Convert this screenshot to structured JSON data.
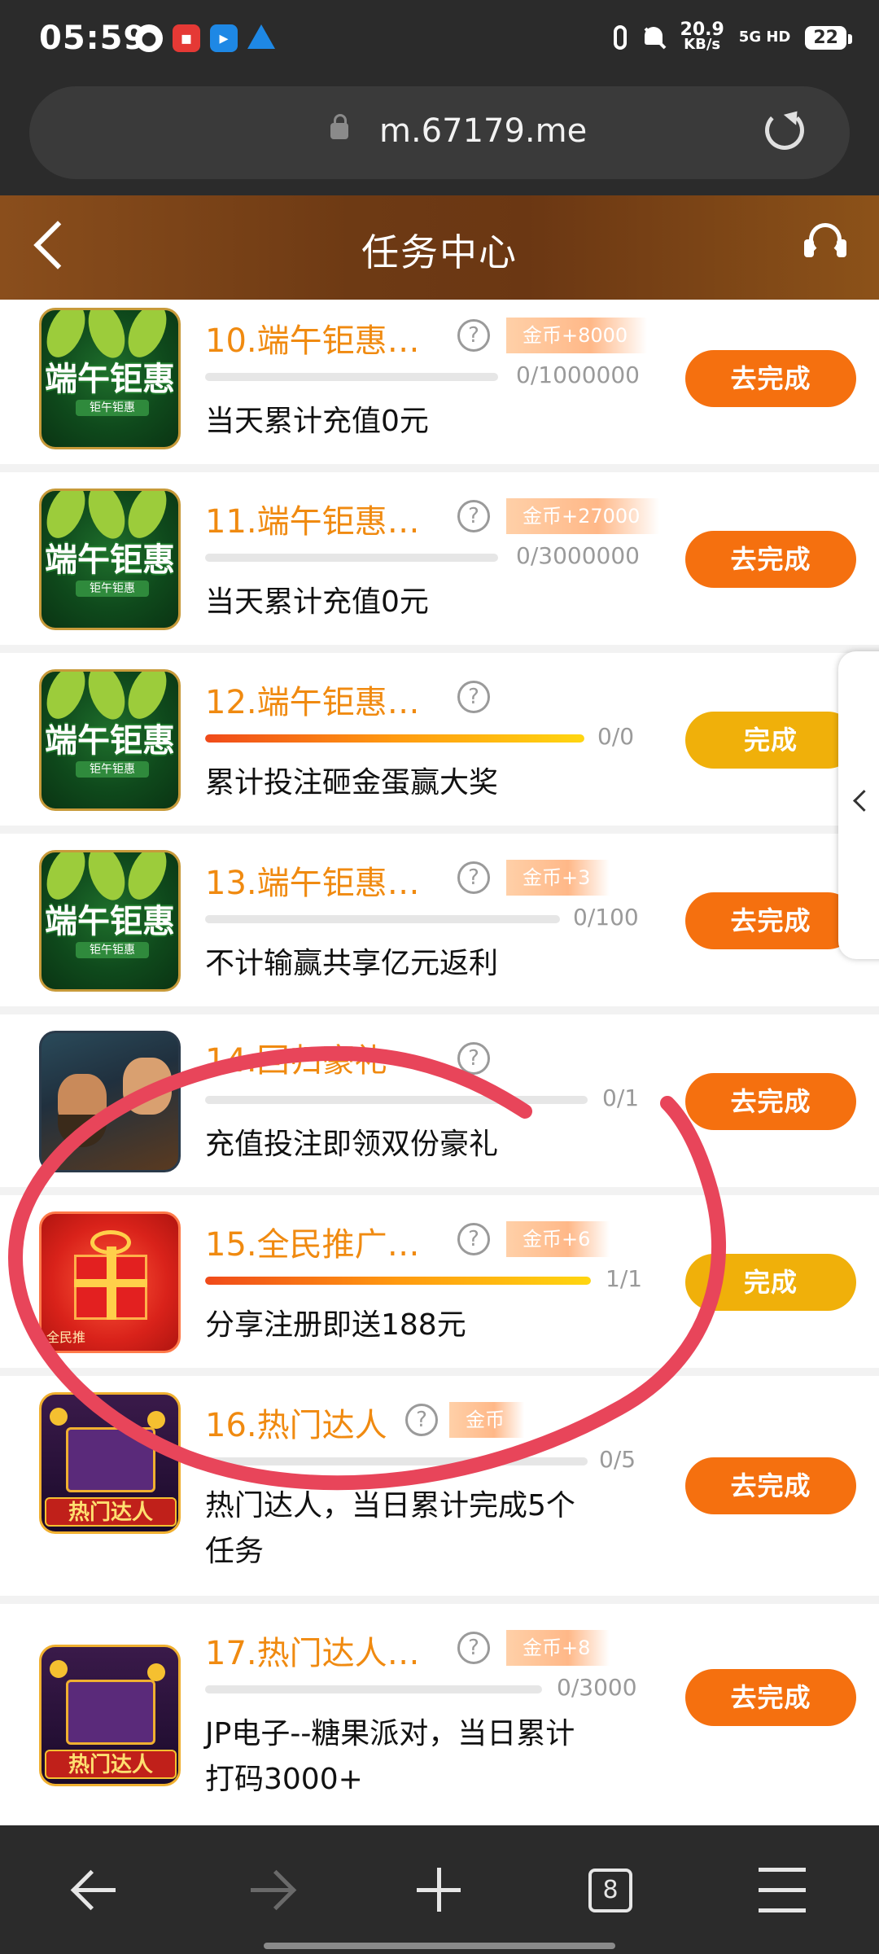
{
  "status_bar": {
    "time": "05:59",
    "net_speed_value": "20.9",
    "net_speed_unit": "KB/s",
    "network": "5G HD",
    "battery": "22"
  },
  "browser": {
    "url": "m.67179.me"
  },
  "header": {
    "title": "任务中心"
  },
  "tasks": [
    {
      "title": "10.端午钜惠…",
      "reward": "金币+8000",
      "progress": "0/1000000",
      "progress_fraction": 0,
      "desc": "当天累计充值0元",
      "action": "去完成",
      "thumb": "端午钜惠",
      "thumb_tag": "钜午钜惠"
    },
    {
      "title": "11.端午钜惠…",
      "reward": "金币+27000",
      "progress": "0/3000000",
      "progress_fraction": 0,
      "desc": "当天累计充值0元",
      "action": "去完成",
      "thumb": "端午钜惠",
      "thumb_tag": "钜午钜惠"
    },
    {
      "title": "12.端午钜惠…",
      "reward": "",
      "progress": "0/0",
      "progress_fraction": 1,
      "desc": "累计投注砸金蛋赢大奖",
      "action": "完成",
      "thumb": "端午钜惠",
      "thumb_tag": "钜午钜惠"
    },
    {
      "title": "13.端午钜惠…",
      "reward": "金币+3",
      "progress": "0/100",
      "progress_fraction": 0,
      "desc": "不计输赢共享亿元返利",
      "action": "去完成",
      "thumb": "端午钜惠",
      "thumb_tag": "钜午钜惠"
    },
    {
      "title": "14.回归豪礼",
      "reward": "",
      "progress": "0/1",
      "progress_fraction": 0,
      "desc": "充值投注即领双份豪礼",
      "action": "去完成"
    },
    {
      "title": "15.全民推广…",
      "reward": "金币+6",
      "progress": "1/1",
      "progress_fraction": 1,
      "desc": "分享注册即送188元",
      "action": "完成",
      "thumb_caption": "全民推"
    },
    {
      "title": "16.热门达人",
      "reward": "金币",
      "progress": "0/5",
      "progress_fraction": 0,
      "desc_line1": "热门达人，当日累计完成5个",
      "desc_line2": "任务",
      "action": "去完成",
      "thumb_caption": "热门达人"
    },
    {
      "title": "17.热门达人…",
      "reward": "金币+8",
      "progress": "0/3000",
      "progress_fraction": 0,
      "desc_line1": "JP电子--糖果派对，当日累计",
      "desc_line2": "打码3000+",
      "action": "去完成",
      "thumb_caption": "热门达人"
    }
  ],
  "nav": {
    "tab_count": "8"
  },
  "colors": {
    "accent_orange": "#f5700f",
    "done_yellow": "#f0b00a",
    "title_orange": "#f08a10",
    "header_brown": "#6e3a14",
    "annotation_red": "#e8455a"
  },
  "icons": [
    "lock-icon",
    "reload-icon",
    "back-icon",
    "support-icon",
    "help-icon",
    "chevron-left-icon",
    "back-arrow-icon",
    "forward-arrow-icon",
    "plus-icon",
    "tabs-icon",
    "menu-icon"
  ]
}
